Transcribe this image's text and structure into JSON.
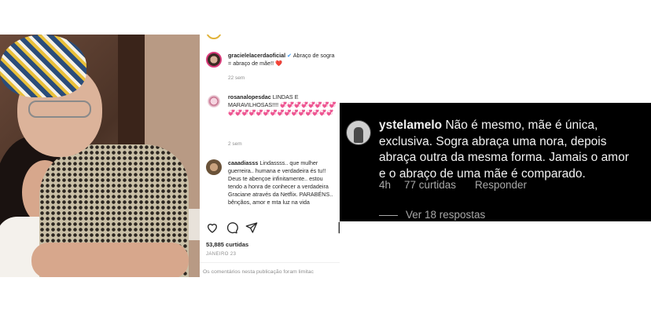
{
  "post": {
    "top_partial": "———— ·———",
    "caption": {
      "username": "gracielelacerdaoficial",
      "verified_icon": "verified-badge-icon",
      "text": "Abraço de sogra = abraço de mãe!! ❤️",
      "time": "22 sem"
    },
    "comments": [
      {
        "username": "rosanalopesdac",
        "text": "LINDAS E MARAVILHOSAS!!!! 💞💞💞💞💞💞💞💞💞💞💞💞💞💞💞💞💞💞💞💞💞💞💞",
        "time": "2 sem"
      },
      {
        "username": "caaadiasss",
        "text": "Lindassss.. que mulher guerreira.. humana e verdadeira és tu!! Deus te abençoe infinitamente.. estou tendo a honra de conhecer a verdadeira Graciane através da Netflix. PARABÉNS.. bênçãos, amor e mta luz na vida"
      }
    ],
    "actions": {
      "like_icon": "heart-icon",
      "comment_icon": "comment-icon",
      "share_icon": "send-icon",
      "save_icon": "bookmark-icon"
    },
    "likes": "53,885 curtidas",
    "date": "JANEIRO 23",
    "comments_off": "Os comentários nesta publicação foram limitac"
  },
  "reply_card": {
    "username": "ystelamelo",
    "text": "Não é mesmo, mãe é única, exclusiva. Sogra abraça uma nora, depois abraça outra da mesma forma. Jamais o amor e o abraço de uma mãe é comparado.",
    "time": "4h",
    "likes": "77 curtidas",
    "reply_label": "Responder",
    "view_replies": "Ver 18 respostas",
    "colors": {
      "background": "#000000",
      "text": "#f2f2f2",
      "meta": "#a8a8a8"
    }
  }
}
